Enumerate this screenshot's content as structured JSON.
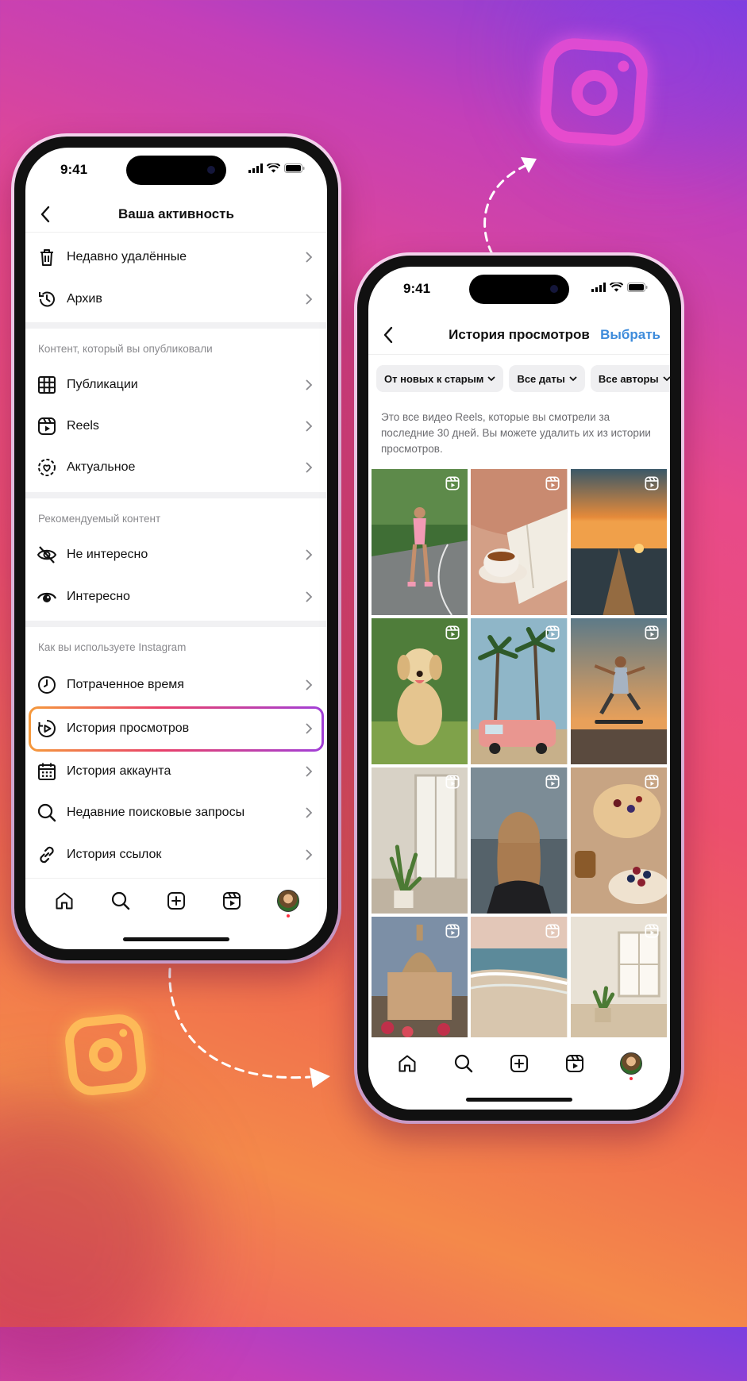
{
  "left_phone": {
    "status": {
      "time": "9:41"
    },
    "header": {
      "title": "Ваша активность"
    },
    "rows_top": [
      {
        "label": "Недавно удалённые",
        "icon": "trash-icon"
      },
      {
        "label": "Архив",
        "icon": "history-icon"
      }
    ],
    "section1": {
      "title": "Контент, который вы опубликовали",
      "rows": [
        {
          "label": "Публикации",
          "icon": "grid-icon"
        },
        {
          "label": "Reels",
          "icon": "reels-icon"
        },
        {
          "label": "Актуальное",
          "icon": "highlights-icon"
        }
      ]
    },
    "section2": {
      "title": "Рекомендуемый контент",
      "rows": [
        {
          "label": "Не интересно",
          "icon": "eye-off-icon"
        },
        {
          "label": "Интересно",
          "icon": "eye-icon"
        }
      ]
    },
    "section3": {
      "title": "Как вы используете Instagram",
      "rows": [
        {
          "label": "Потраченное время",
          "icon": "clock-icon"
        },
        {
          "label": "История просмотров",
          "icon": "watch-history-icon",
          "highlighted": true
        },
        {
          "label": "История аккаунта",
          "icon": "calendar-icon"
        },
        {
          "label": "Недавние поисковые запросы",
          "icon": "search-icon"
        },
        {
          "label": "История ссылок",
          "icon": "link-icon"
        }
      ]
    }
  },
  "right_phone": {
    "status": {
      "time": "9:41"
    },
    "header": {
      "title": "История просмотров",
      "action": "Выбрать"
    },
    "filters": [
      "От новых к старым",
      "Все даты",
      "Все авторы"
    ],
    "description": "Это все видео Reels, которые вы смотрели за последние 30 дней. Вы можете удалить их из истории просмотров.",
    "tiles": [
      {
        "subject": "roller-skater"
      },
      {
        "subject": "coffee-book"
      },
      {
        "subject": "sunset-sea"
      },
      {
        "subject": "golden-retriever"
      },
      {
        "subject": "palm-van"
      },
      {
        "subject": "skateboarder"
      },
      {
        "subject": "window-plant"
      },
      {
        "subject": "woman-back"
      },
      {
        "subject": "dessert-berries"
      },
      {
        "subject": "cathedral"
      },
      {
        "subject": "beach-waves"
      },
      {
        "subject": "bright-room"
      }
    ]
  },
  "tabbar_icons": [
    "home-icon",
    "search-icon",
    "create-icon",
    "reels-icon",
    "profile-avatar"
  ],
  "colors": {
    "accent_link": "#3d8bdb",
    "highlight_start": "#f59a3c",
    "highlight_end": "#a13fd8",
    "notification": "#ff3040"
  }
}
